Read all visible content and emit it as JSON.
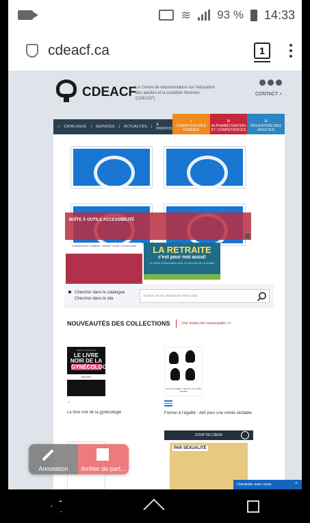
{
  "status_bar": {
    "battery": "93 %",
    "time": "14:33",
    "icons": [
      "video-icon",
      "cast-icon",
      "wifi-icon",
      "signal-icon",
      "battery-icon"
    ]
  },
  "browser": {
    "url": "cdeacf.ca",
    "tab_count": "1"
  },
  "site": {
    "logo": "CDEACF",
    "tagline": "Le Centre de documentation sur l'éducation des adultes et la condition féminine (CDEACF)",
    "contact": "CONTACT",
    "nav": {
      "items": [
        "CATALOGUE",
        "SERVICES",
        "ACTUALITÉS",
        "À PROPOS"
      ],
      "tabs": [
        {
          "label": "CONDITION DES FEMMES",
          "color": "#f08a1c"
        },
        {
          "label": "ALPHABÉTISATION ET COMPÉTENCES",
          "color": "#c8263a"
        },
        {
          "label": "ÉDUCATION DES ADULTES",
          "color": "#2c86c2"
        }
      ]
    },
    "banner": "BOÎTE À OUTILS ACCESSIBILITÉ",
    "promo1_title": "Compétences multiples : famille, travail, communauté",
    "promo2": {
      "title": "LA RETRAITE",
      "subtitle": "c'est pour moi aussi!",
      "note": "Un guide d'information pour les femmes sur la retraite"
    },
    "search": {
      "option1": "Chercher dans le catalogue",
      "option2": "Chercher dans le site",
      "placeholder": "Entrer un ou plusieurs mots clés"
    },
    "news": {
      "heading": "NOUVEAUTÉS DES COLLECTIONS",
      "link": "Voir toutes les nouveautés >>"
    },
    "books": [
      {
        "cover_line1": "LE LIVRE NOIR DE LA",
        "cover_line2": "GYNÉCOLOGIE",
        "title": "Le livre noir de la gynécologie"
      },
      {
        "cover_caption": "Former à l'égalité : défi pour une mixité véritable",
        "title": "Former à l'égalité : défi pour une mixité véritable"
      }
    ],
    "coup_de_coeur": "COUP DE CŒUR",
    "coup_cover": "PAR SEXUALITÉ",
    "chat": "Clavarder avec nous"
  },
  "widget": {
    "annotation": "Annotation",
    "stop": "Arrêter de part..."
  }
}
